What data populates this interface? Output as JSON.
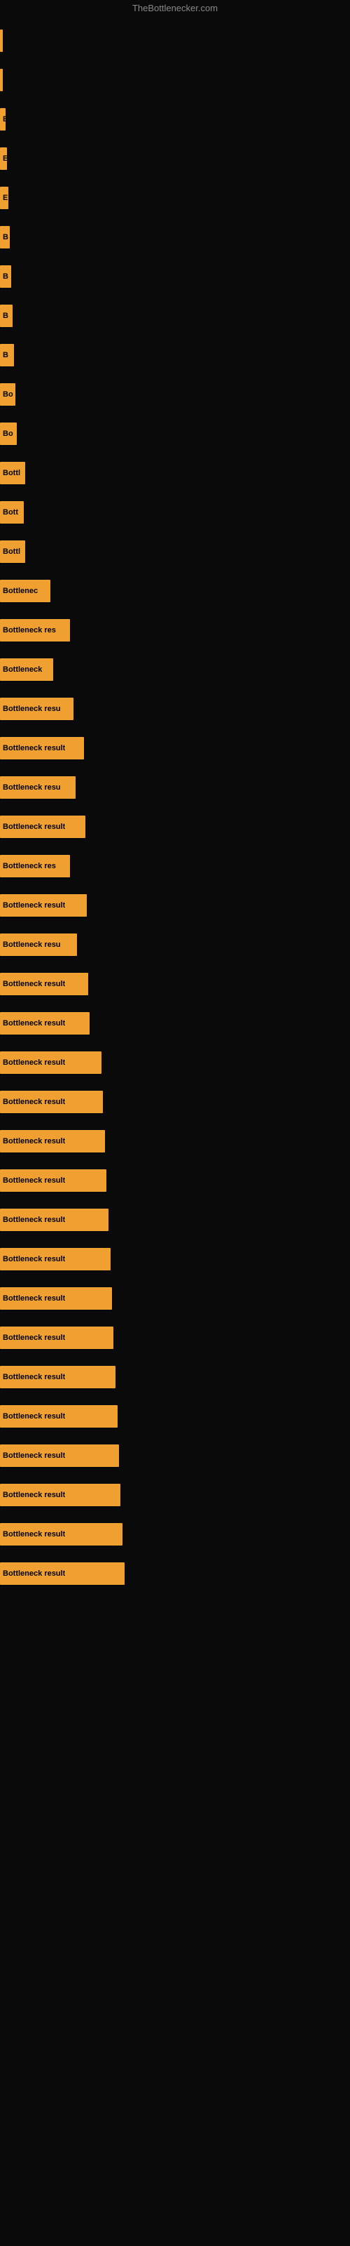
{
  "site": {
    "title": "TheBottlenecker.com"
  },
  "bars": [
    {
      "label": "",
      "width": 2
    },
    {
      "label": "",
      "width": 2
    },
    {
      "label": "E",
      "width": 8
    },
    {
      "label": "E",
      "width": 10
    },
    {
      "label": "E",
      "width": 12
    },
    {
      "label": "B",
      "width": 14
    },
    {
      "label": "B",
      "width": 16
    },
    {
      "label": "B",
      "width": 18
    },
    {
      "label": "B",
      "width": 20
    },
    {
      "label": "Bo",
      "width": 22
    },
    {
      "label": "Bo",
      "width": 24
    },
    {
      "label": "Bottl",
      "width": 36
    },
    {
      "label": "Bott",
      "width": 34
    },
    {
      "label": "Bottl",
      "width": 36
    },
    {
      "label": "Bottlenec",
      "width": 72
    },
    {
      "label": "Bottleneck res",
      "width": 100
    },
    {
      "label": "Bottleneck",
      "width": 76
    },
    {
      "label": "Bottleneck resu",
      "width": 105
    },
    {
      "label": "Bottleneck result",
      "width": 120
    },
    {
      "label": "Bottleneck resu",
      "width": 108
    },
    {
      "label": "Bottleneck result",
      "width": 122
    },
    {
      "label": "Bottleneck res",
      "width": 100
    },
    {
      "label": "Bottleneck result",
      "width": 124
    },
    {
      "label": "Bottleneck resu",
      "width": 110
    },
    {
      "label": "Bottleneck result",
      "width": 126
    },
    {
      "label": "Bottleneck result",
      "width": 128
    },
    {
      "label": "Bottleneck result",
      "width": 145
    },
    {
      "label": "Bottleneck result",
      "width": 147
    },
    {
      "label": "Bottleneck result",
      "width": 150
    },
    {
      "label": "Bottleneck result",
      "width": 152
    },
    {
      "label": "Bottleneck result",
      "width": 155
    },
    {
      "label": "Bottleneck result",
      "width": 158
    },
    {
      "label": "Bottleneck result",
      "width": 160
    },
    {
      "label": "Bottleneck result",
      "width": 162
    },
    {
      "label": "Bottleneck result",
      "width": 165
    },
    {
      "label": "Bottleneck result",
      "width": 168
    },
    {
      "label": "Bottleneck result",
      "width": 170
    },
    {
      "label": "Bottleneck result",
      "width": 172
    },
    {
      "label": "Bottleneck result",
      "width": 175
    },
    {
      "label": "Bottleneck result",
      "width": 178
    }
  ]
}
